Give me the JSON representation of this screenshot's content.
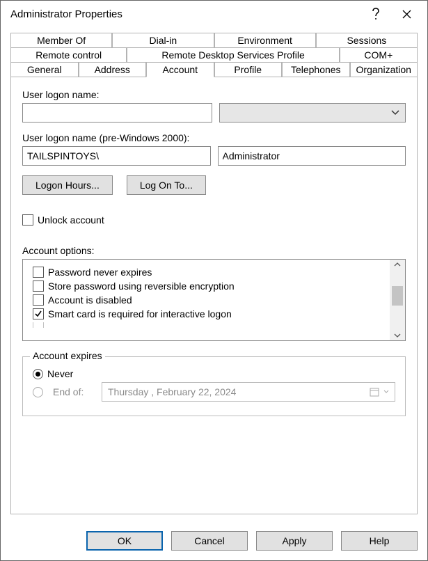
{
  "window": {
    "title": "Administrator Properties"
  },
  "tabs": {
    "row1": [
      "Member Of",
      "Dial-in",
      "Environment",
      "Sessions"
    ],
    "row2": [
      "Remote control",
      "Remote Desktop Services Profile",
      "COM+"
    ],
    "row3": [
      "General",
      "Address",
      "Account",
      "Profile",
      "Telephones",
      "Organization"
    ],
    "active": "Account"
  },
  "account": {
    "logon_name_label": "User logon name:",
    "logon_name_value": "",
    "upn_suffix_value": "",
    "pre2000_label": "User logon name (pre-Windows 2000):",
    "pre2000_domain": "TAILSPINTOYS\\",
    "pre2000_user": "Administrator",
    "logon_hours_btn": "Logon Hours...",
    "log_on_to_btn": "Log On To...",
    "unlock_label": "Unlock account",
    "options_label": "Account options:",
    "options": [
      {
        "label": "Password never expires",
        "checked": false
      },
      {
        "label": "Store password using reversible encryption",
        "checked": false
      },
      {
        "label": "Account is disabled",
        "checked": false
      },
      {
        "label": "Smart card is required for interactive logon",
        "checked": true
      }
    ],
    "expires": {
      "legend": "Account expires",
      "never_label": "Never",
      "endof_label": "End of:",
      "selected": "never",
      "date_display": "Thursday  ,   February   22,  2024"
    }
  },
  "footer": {
    "ok": "OK",
    "cancel": "Cancel",
    "apply": "Apply",
    "help": "Help"
  }
}
